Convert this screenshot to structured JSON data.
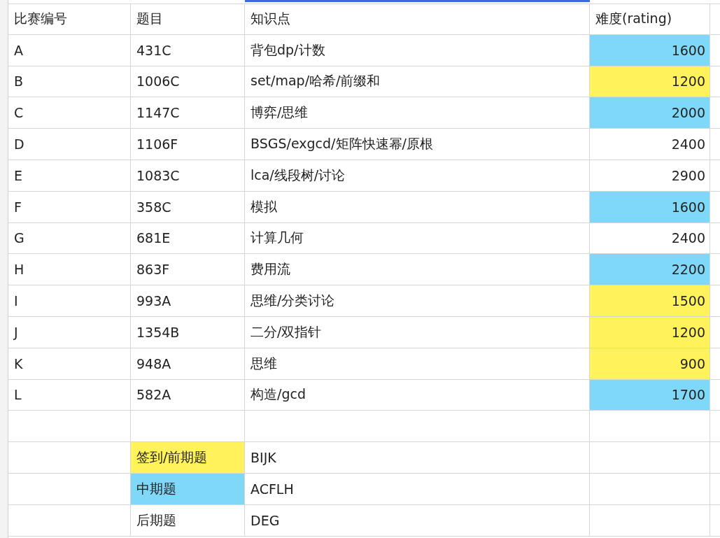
{
  "table": {
    "columns": [
      "比赛编号",
      "题目",
      "知识点",
      "难度(rating)"
    ],
    "rows": [
      {
        "id": "A",
        "problem": "431C",
        "topics": "背包dp/计数",
        "rating": "1600",
        "color": "#7fd8f8"
      },
      {
        "id": "B",
        "problem": "1006C",
        "topics": "set/map/哈希/前缀和",
        "rating": "1200",
        "color": "#fff25a"
      },
      {
        "id": "C",
        "problem": "1147C",
        "topics": "博弈/思维",
        "rating": "2000",
        "color": "#7fd8f8"
      },
      {
        "id": "D",
        "problem": "1106F",
        "topics": "BSGS/exgcd/矩阵快速幂/原根",
        "rating": "2400"
      },
      {
        "id": "E",
        "problem": "1083C",
        "topics": "lca/线段树/讨论",
        "rating": "2900"
      },
      {
        "id": "F",
        "problem": "358C",
        "topics": "模拟",
        "rating": "1600",
        "color": "#7fd8f8"
      },
      {
        "id": "G",
        "problem": "681E",
        "topics": "计算几何",
        "rating": "2400"
      },
      {
        "id": "H",
        "problem": "863F",
        "topics": "费用流",
        "rating": "2200",
        "color": "#7fd8f8"
      },
      {
        "id": "I",
        "problem": "993A",
        "topics": "思维/分类讨论",
        "rating": "1500",
        "color": "#fff25a"
      },
      {
        "id": "J",
        "problem": "1354B",
        "topics": "二分/双指针",
        "rating": "1200",
        "color": "#fff25a"
      },
      {
        "id": "K",
        "problem": "948A",
        "topics": "思维",
        "rating": "900",
        "color": "#fff25a"
      },
      {
        "id": "L",
        "problem": "582A",
        "topics": "构造/gcd",
        "rating": "1700",
        "color": "#7fd8f8"
      }
    ],
    "legend": [
      {
        "label": "签到/前期题",
        "problems": "BIJK",
        "color": "#fff25a"
      },
      {
        "label": "中期题",
        "problems": "ACFLH",
        "color": "#7fd8f8"
      },
      {
        "label": "后期题",
        "problems": "DEG"
      }
    ]
  }
}
